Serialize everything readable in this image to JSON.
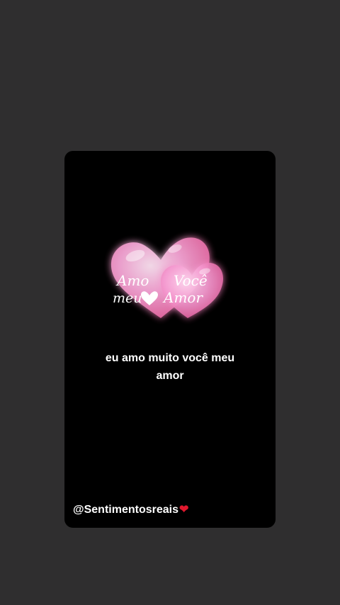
{
  "story": {
    "sticker": {
      "line1_left": "Amo",
      "line1_right": "Você",
      "line2_left": "meu",
      "line2_right": "Amor",
      "icon": "double-pink-heart-icon"
    },
    "message": {
      "line1": "eu amo muito você meu",
      "line2": "amor"
    },
    "handle": {
      "text": "@Sentimentosreais",
      "emoji": "❤"
    }
  },
  "colors": {
    "page_background": "#2f2e2f",
    "card_background": "#000000",
    "heart_pink": "#f59ad0",
    "heart_emoji_red": "#e0182d",
    "text": "#ffffff"
  }
}
